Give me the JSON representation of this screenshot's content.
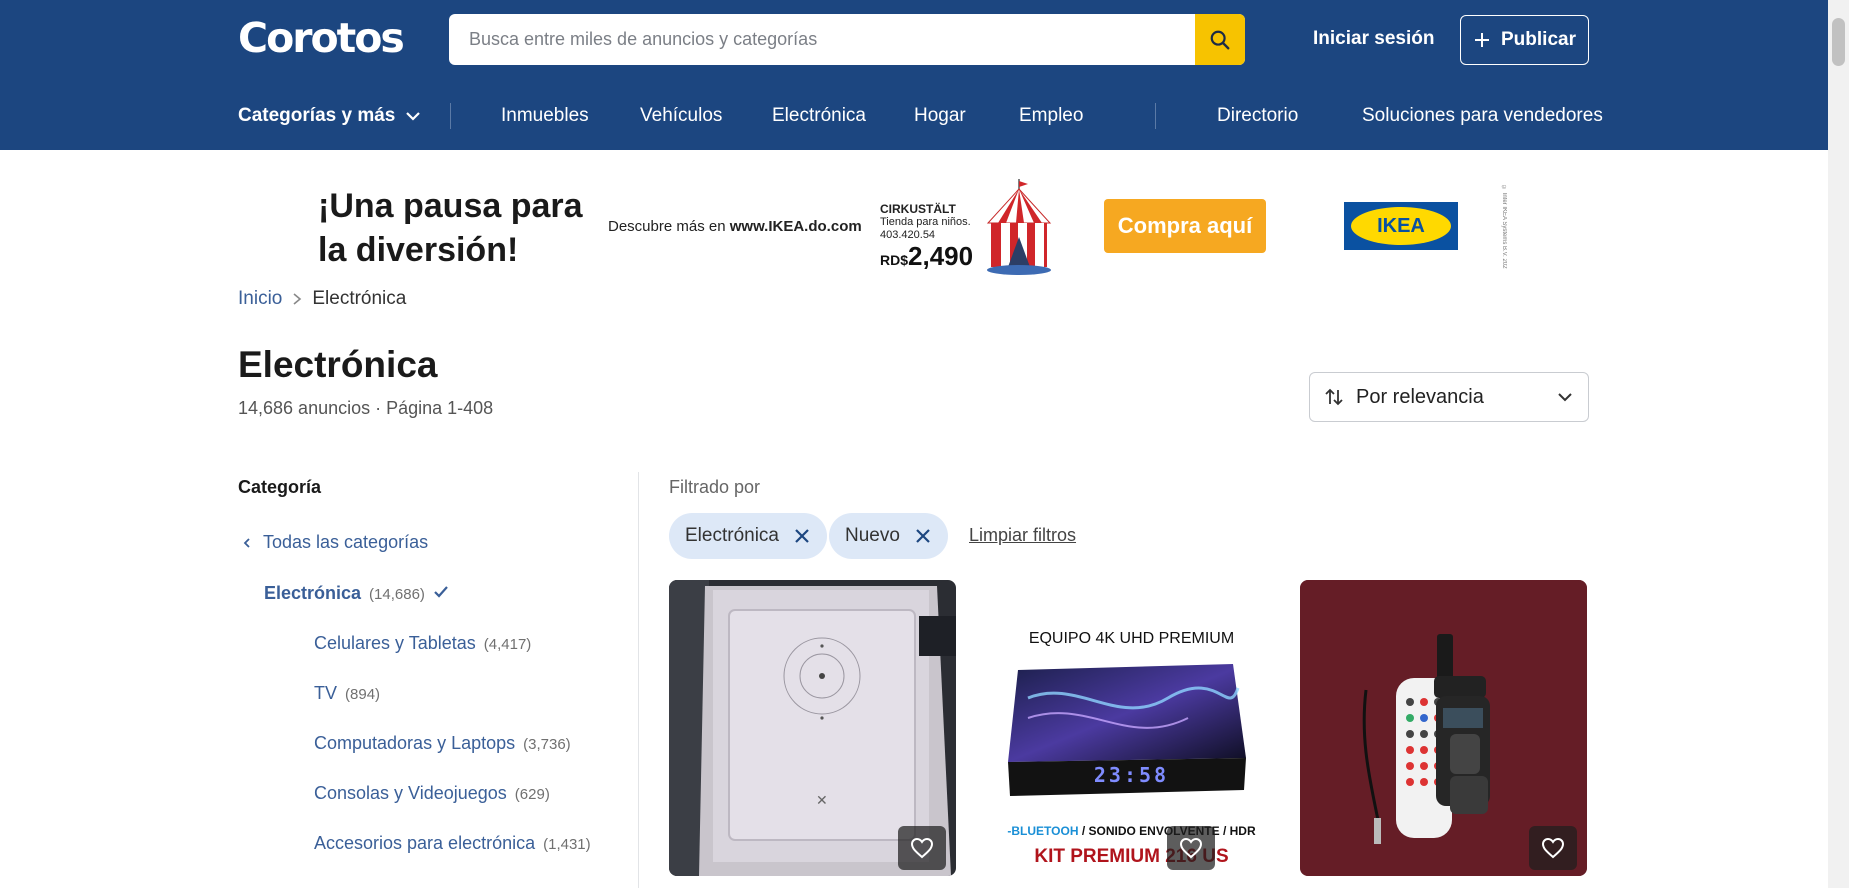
{
  "header": {
    "logo": "Corotos",
    "search_placeholder": "Busca entre miles de anuncios y categorías",
    "login_label": "Iniciar sesión",
    "publish_label": "Publicar"
  },
  "nav": {
    "categories_label": "Categorías y más",
    "links": [
      "Inmuebles",
      "Vehículos",
      "Electrónica",
      "Hogar",
      "Empleo"
    ],
    "directory_label": "Directorio",
    "sellers_label": "Soluciones para vendedores"
  },
  "banner": {
    "headline": "¡Una pausa para la diversión!",
    "sub_prefix": "Descubre más en ",
    "sub_site": "www.IKEA.do.com",
    "product_name": "CIRKUSTÄLT",
    "product_desc": "Tienda para niños.",
    "product_code": "403.420.54",
    "price_currency": "RD$",
    "price_amount": "2,490",
    "cta_label": "Compra aquí",
    "brand": "IKEA",
    "legal": "© Inter IKEA Systems B.V. 2023"
  },
  "breadcrumb": {
    "home": "Inicio",
    "current": "Electrónica"
  },
  "page": {
    "title": "Electrónica",
    "meta": "14,686 anuncios · Página 1-408",
    "sort_label": "Por relevancia"
  },
  "sidebar": {
    "title": "Categoría",
    "all_label": "Todas las categorías",
    "active": {
      "label": "Electrónica",
      "count": "(14,686)"
    },
    "items": [
      {
        "label": "Celulares y Tabletas",
        "count": "(4,417)"
      },
      {
        "label": "TV",
        "count": "(894)"
      },
      {
        "label": "Computadoras y Laptops",
        "count": "(3,736)"
      },
      {
        "label": "Consolas y Videojuegos",
        "count": "(629)"
      },
      {
        "label": "Accesorios para electrónica",
        "count": "(1,431)"
      }
    ]
  },
  "filters": {
    "label": "Filtrado por",
    "chips": [
      "Electrónica",
      "Nuevo"
    ],
    "clear_label": "Limpiar filtros"
  },
  "cards": {
    "card2_top": "EQUIPO 4K UHD PREMIUM",
    "card2_clock": "23:58",
    "card2_features_a": "-BLUETOOH",
    "card2_features_b": " / SONIDO ENVOLVENTE / HDR",
    "card2_bottom": "KIT PREMIUM 216 US"
  },
  "colors": {
    "header_bg": "#1c4680",
    "search_button": "#f7c300",
    "link_blue": "#3a5f98",
    "chip_bg": "#dde8f7",
    "banner_cta": "#f6a821",
    "ikea_blue": "#0a51a1",
    "ikea_yellow": "#ffd900"
  }
}
